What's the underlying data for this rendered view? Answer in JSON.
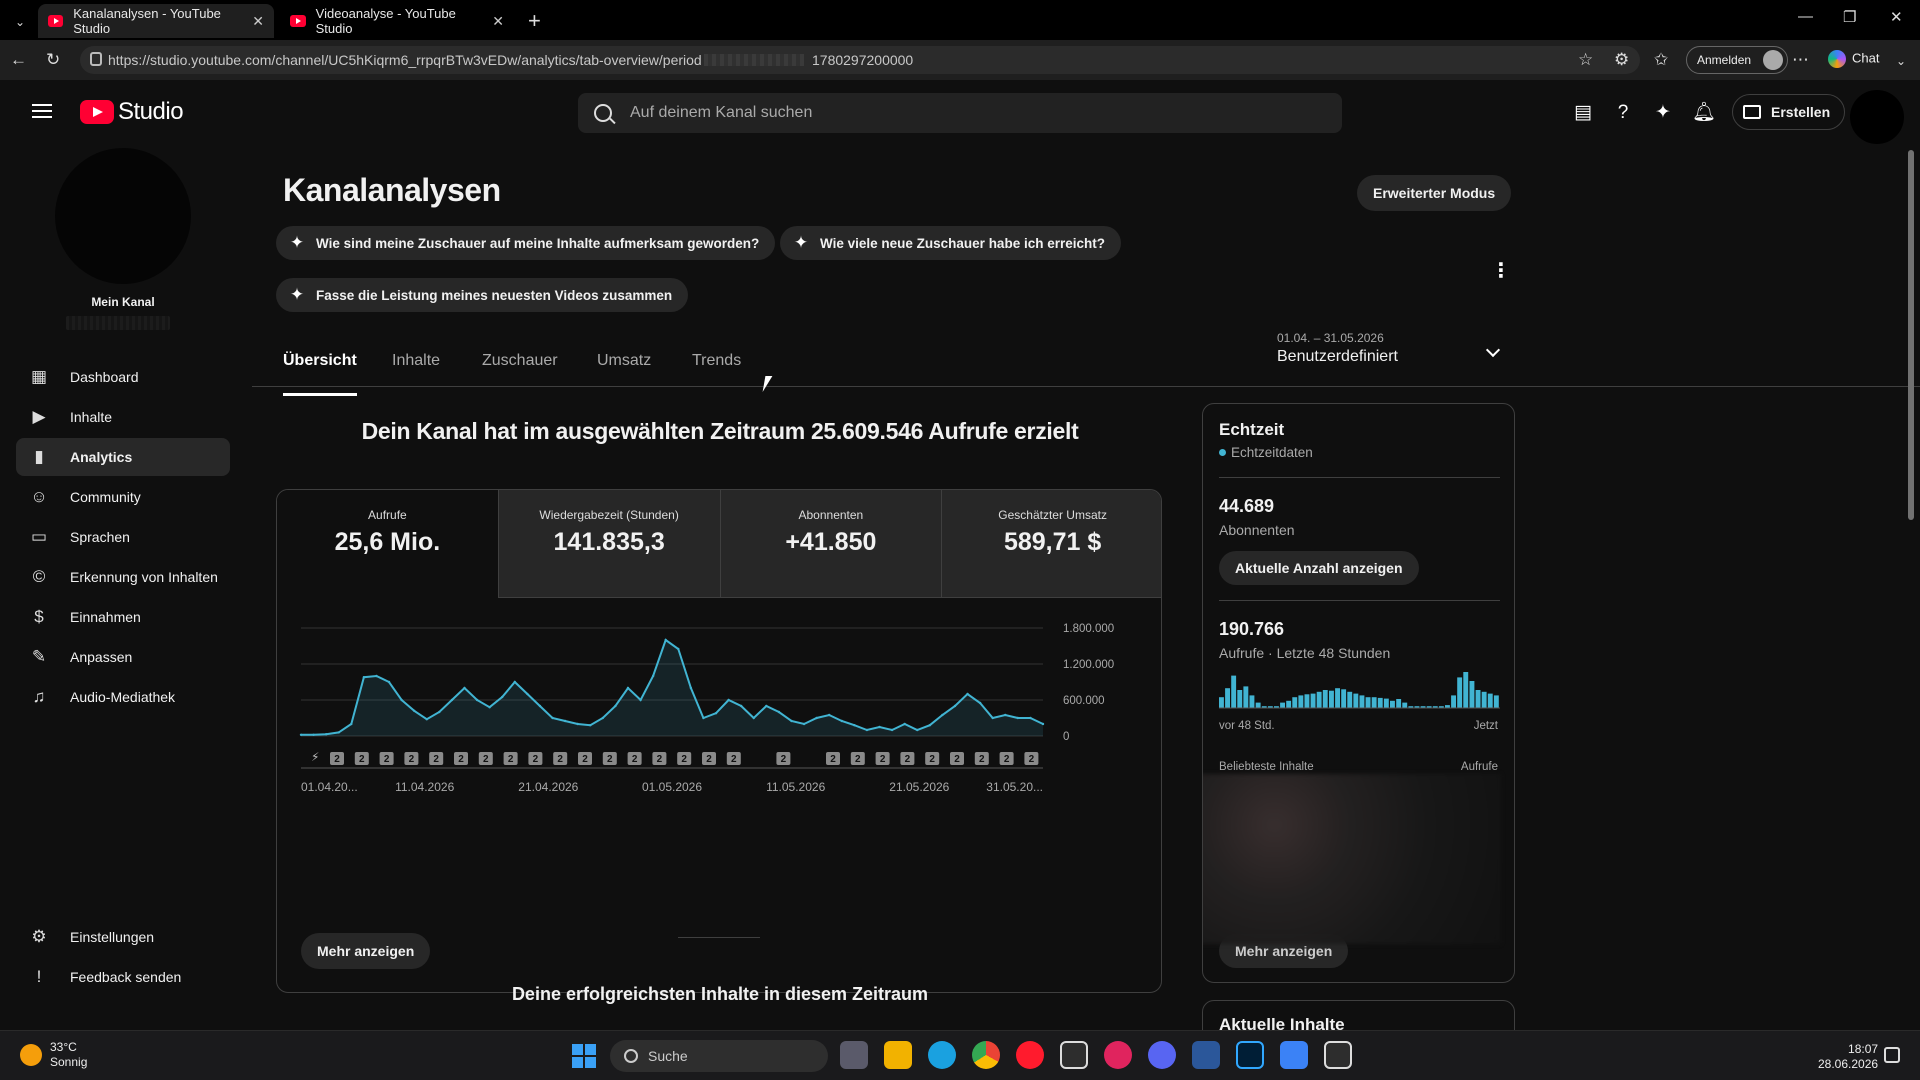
{
  "browser": {
    "tabs": [
      {
        "title": "Kanalanalysen - YouTube Studio",
        "active": true
      },
      {
        "title": "Videoanalyse - YouTube Studio",
        "active": false
      }
    ],
    "url": "https://studio.youtube.com/channel/UC5hKiqrm6_rrpqrBTw3vEDw/analytics/tab-overview/period",
    "url_tail": "1780297200000",
    "signin_label": "Anmelden",
    "chat_label": "Chat"
  },
  "header": {
    "logo_text": "Studio",
    "search_placeholder": "Auf deinem Kanal suchen",
    "create_label": "Erstellen"
  },
  "sidebar": {
    "channel_label": "Mein Kanal",
    "items": [
      {
        "label": "Dashboard",
        "icon": "dashboard-icon",
        "active": false
      },
      {
        "label": "Inhalte",
        "icon": "content-icon",
        "active": false
      },
      {
        "label": "Analytics",
        "icon": "analytics-icon",
        "active": true
      },
      {
        "label": "Community",
        "icon": "community-icon",
        "active": false
      },
      {
        "label": "Sprachen",
        "icon": "subtitles-icon",
        "active": false
      },
      {
        "label": "Erkennung von Inhalten",
        "icon": "copyright-icon",
        "active": false
      },
      {
        "label": "Einnahmen",
        "icon": "monetization-icon",
        "active": false
      },
      {
        "label": "Anpassen",
        "icon": "customize-icon",
        "active": false
      },
      {
        "label": "Audio-Mediathek",
        "icon": "audio-library-icon",
        "active": false
      }
    ],
    "footer": [
      {
        "label": "Einstellungen",
        "icon": "gear-icon"
      },
      {
        "label": "Feedback senden",
        "icon": "feedback-icon"
      }
    ]
  },
  "main": {
    "title": "Kanalanalysen",
    "advanced_mode_label": "Erweiterter Modus",
    "suggestions": [
      "Wie sind meine Zuschauer auf meine Inhalte aufmerksam geworden?",
      "Wie viele neue Zuschauer habe ich erreicht?",
      "Fasse die Leistung meines neuesten Videos zusammen"
    ],
    "tabs": [
      "Übersicht",
      "Inhalte",
      "Zuschauer",
      "Umsatz",
      "Trends"
    ],
    "active_tab": "Übersicht",
    "date_range": {
      "range": "01.04. – 31.05.2026",
      "label": "Benutzerdefiniert"
    },
    "headline": "Dein Kanal hat im ausgewählten Zeitraum 25.609.546 Aufrufe erzielt",
    "metrics": [
      {
        "label": "Aufrufe",
        "value": "25,6 Mio."
      },
      {
        "label": "Wiedergabezeit (Stunden)",
        "value": "141.835,3"
      },
      {
        "label": "Abonnenten",
        "value": "+41.850"
      },
      {
        "label": "Geschätzter Umsatz",
        "value": "589,71 $"
      }
    ],
    "more_label": "Mehr anzeigen",
    "top_content_title": "Deine erfolgreichsten Inhalte in diesem Zeitraum"
  },
  "realtime": {
    "title": "Echtzeit",
    "subtitle": "Echtzeitdaten",
    "subscribers_value": "44.689",
    "subscribers_label": "Abonnenten",
    "show_count_label": "Aktuelle Anzahl anzeigen",
    "views_value": "190.766",
    "views_label": "Aufrufe · Letzte 48 Stunden",
    "tick_start": "vor 48 Std.",
    "tick_end": "Jetzt",
    "top_content_label": "Beliebteste Inhalte",
    "top_content_metric": "Aufrufe",
    "more_label": "Mehr anzeigen",
    "bars": [
      0.3,
      0.55,
      0.9,
      0.5,
      0.6,
      0.35,
      0.15,
      0.05,
      0.05,
      0.05,
      0.15,
      0.2,
      0.3,
      0.35,
      0.38,
      0.4,
      0.45,
      0.5,
      0.48,
      0.55,
      0.52,
      0.45,
      0.4,
      0.35,
      0.3,
      0.3,
      0.28,
      0.26,
      0.2,
      0.25,
      0.15,
      0.05,
      0.05,
      0.05,
      0.05,
      0.05,
      0.05,
      0.08,
      0.35,
      0.85,
      1.0,
      0.75,
      0.5,
      0.45,
      0.4,
      0.35
    ]
  },
  "card2_title": "Aktuelle Inhalte",
  "taskbar": {
    "weather_temp": "33°C",
    "weather_desc": "Sonnig",
    "search_label": "Suche",
    "time": "18:07",
    "date": "28.06.2026"
  },
  "chart_data": {
    "type": "line",
    "x": [
      "01.04.20...",
      "11.04.2026",
      "21.04.2026",
      "01.05.2026",
      "11.05.2026",
      "21.05.2026",
      "31.05.20..."
    ],
    "x_tick_labels": [
      "01.04.20...",
      "11.04.2026",
      "21.04.2026",
      "01.05.2026",
      "11.05.2026",
      "21.05.2026",
      "31.05.20..."
    ],
    "y_tick_labels": [
      "1.800.000",
      "1.200.000",
      "600.000",
      "0"
    ],
    "ylim": [
      0,
      1800000
    ],
    "series": [
      {
        "values": [
          20000,
          20000,
          30000,
          60000,
          200000,
          980000,
          1000000,
          900000,
          600000,
          420000,
          280000,
          400000,
          600000,
          800000,
          600000,
          480000,
          650000,
          900000,
          700000,
          500000,
          300000,
          250000,
          200000,
          180000,
          300000,
          500000,
          800000,
          600000,
          1000000,
          1600000,
          1450000,
          800000,
          300000,
          380000,
          600000,
          500000,
          300000,
          500000,
          400000,
          250000,
          200000,
          300000,
          350000,
          250000,
          180000,
          100000,
          150000,
          100000,
          200000,
          100000,
          180000,
          350000,
          500000,
          700000,
          550000,
          300000,
          350000,
          300000,
          300000,
          200000
        ]
      }
    ],
    "annotation_markers": [
      "2",
      "2",
      "2",
      "2",
      "2",
      "2",
      "2",
      "2",
      "2",
      "2",
      "2",
      "2",
      "2",
      "2",
      "2",
      "2",
      "2",
      "2",
      "2",
      "2",
      "2",
      "2",
      "2",
      "2",
      "2",
      "2",
      "2"
    ],
    "grid": true
  }
}
